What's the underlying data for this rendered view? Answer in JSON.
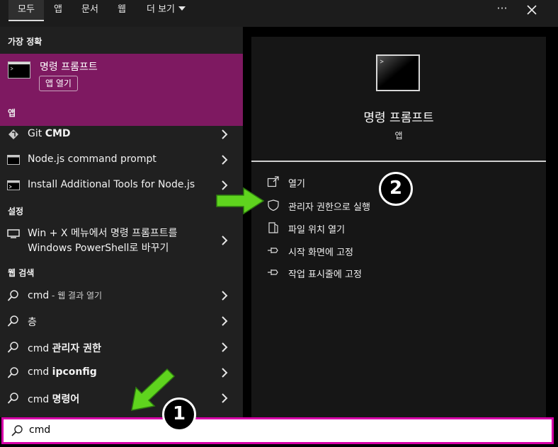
{
  "tabs": [
    {
      "label": "모두",
      "active": true
    },
    {
      "label": "앱"
    },
    {
      "label": "문서"
    },
    {
      "label": "웹"
    },
    {
      "label": "더 보기"
    }
  ],
  "window": {
    "more_label": "···"
  },
  "best_match": {
    "heading": "가장 정확",
    "title": "명령 프롬프트",
    "open_label": "앱 열기",
    "icon": "cmd-icon"
  },
  "apps": {
    "heading": "앱",
    "items": [
      {
        "label": "Git ",
        "bold": "CMD",
        "icon": "git-icon"
      },
      {
        "label": "Node.js command prompt",
        "icon": "cmd-icon"
      },
      {
        "label": "Install Additional Tools for Node.js",
        "icon": "cmd-icon"
      }
    ]
  },
  "settings": {
    "heading": "설정",
    "item_line1": "Win + X 메뉴에서 명령 프롬프트를",
    "item_line2": "Windows PowerShell로 바꾸기",
    "icon": "monitor-icon"
  },
  "web": {
    "heading": "웹 검색",
    "items": [
      {
        "prefix": "cmd",
        "suffix": " - 웹 결과 열기",
        "style": "dim"
      },
      {
        "prefix": "층",
        "suffix": "",
        "style": "none"
      },
      {
        "prefix": "cmd ",
        "suffix": "관리자 권한",
        "style": "bold"
      },
      {
        "prefix": "cmd ",
        "suffix": "ipconfig",
        "style": "bold"
      },
      {
        "prefix": "cmd ",
        "suffix": "명령어",
        "style": "bold"
      }
    ]
  },
  "detail": {
    "title": "명령 프롬프트",
    "subtitle": "앱",
    "actions": [
      {
        "label": "열기",
        "icon": "open-icon"
      },
      {
        "label": "관리자 권한으로 실행",
        "icon": "shield-icon"
      },
      {
        "label": "파일 위치 열기",
        "icon": "file-location-icon"
      },
      {
        "label": "시작 화면에 고정",
        "icon": "pin-icon"
      },
      {
        "label": "작업 표시줄에 고정",
        "icon": "pin-icon"
      }
    ]
  },
  "search": {
    "value": "cmd"
  },
  "annotations": {
    "step1": "1",
    "step2": "2",
    "arrow_color": "#5fd41e",
    "border_color": "#d700a8"
  }
}
